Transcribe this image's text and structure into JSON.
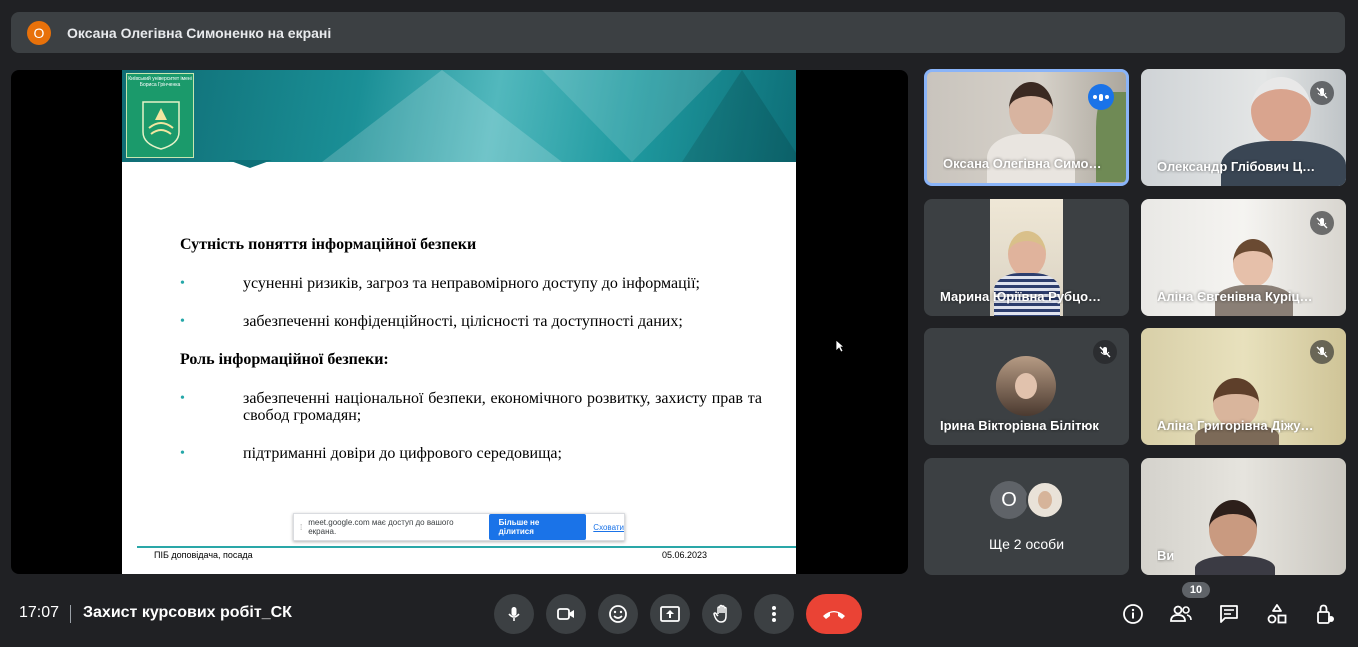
{
  "presenter_bar": {
    "avatar_initial": "О",
    "title": "Оксана Олегівна Симоненко на екрані",
    "avatar_color": "#e8710a"
  },
  "slide": {
    "logo_text": "Київський університет імені Бориса Грінченка",
    "section1_heading": "Сутність поняття інформаційної безпеки",
    "section1_bullets": [
      "усуненні ризиків, загроз та неправомірного доступу до інформації;",
      "забезпеченні конфіденційності, цілісності та доступності даних;"
    ],
    "section2_heading": "Роль інформаційної безпеки:",
    "section2_bullets": [
      "забезпеченні національної безпеки, економічного розвитку, захисту прав та свобод громадян;",
      "підтриманні довіри до цифрового середовища;"
    ],
    "footer_left": "ПІБ доповідача, посада",
    "footer_right": "05.06.2023",
    "bullet_glyph": "•"
  },
  "share_notice": {
    "grip": "⁞",
    "message": "meet.google.com має доступ до вашого екрана.",
    "stop_label": "Більше не ділитися",
    "hide_label": "Сховати"
  },
  "participants": [
    {
      "name": "Оксана Олегівна Симо…",
      "speaking": true
    },
    {
      "name": "Олександр Глібович Ц…",
      "muted": true
    },
    {
      "name": "Марина Юріївна Рубцо…"
    },
    {
      "name": "Аліна Євгенівна Куріц…",
      "muted": true
    },
    {
      "name": "Ірина Вікторівна Білітюк",
      "muted": true
    },
    {
      "name": "Аліна Григорівна Діжу…",
      "muted": true
    },
    {
      "name": "Ви"
    }
  ],
  "more_tile": {
    "label": "Ще 2 особи",
    "avatar_initial": "О"
  },
  "bottom": {
    "time": "17:07",
    "meeting_name": "Захист курсових робіт_СК",
    "participant_count": "10"
  },
  "colors": {
    "background": "#202124",
    "tile": "#3c4043",
    "accent": "#1a73e8",
    "hangup": "#ea4335",
    "active_border": "#8ab4f8"
  },
  "icons": {
    "mic": "mic-icon",
    "camera": "camera-icon",
    "emoji": "emoji-icon",
    "present": "present-screen-icon",
    "raise_hand": "raise-hand-icon",
    "more": "more-options-icon",
    "hangup": "hangup-icon",
    "info": "info-icon",
    "people": "people-icon",
    "chat": "chat-icon",
    "activities": "activities-icon",
    "host_controls": "host-controls-icon"
  }
}
